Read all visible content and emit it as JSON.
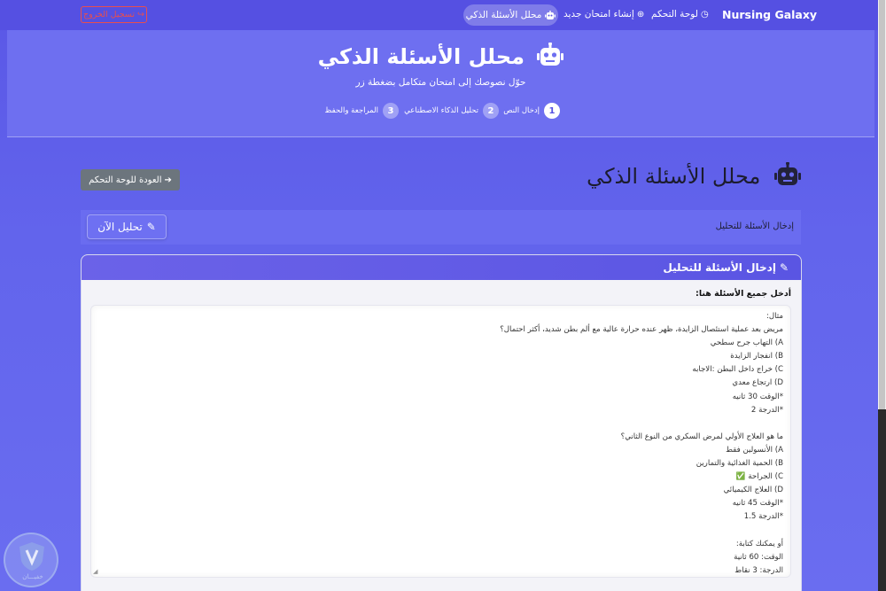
{
  "navbar": {
    "brand": "Nursing Galaxy",
    "dashboard": "لوحة التحكم",
    "new_exam": "إنشاء امتحان جديد",
    "analyzer": "محلل الأسئلة الذكي",
    "logout": "تسجيل الخروج"
  },
  "hero": {
    "title": "محلل الأسئلة الذكي",
    "subtitle": "حوّل نصوصك إلى امتحان متكامل بضغطة زر",
    "steps": [
      {
        "num": "1",
        "label": "إدخال النص"
      },
      {
        "num": "2",
        "label": "تحليل الذكاء الاصطناعي"
      },
      {
        "num": "3",
        "label": "المراجعة والحفظ"
      }
    ]
  },
  "page": {
    "title": "محلل الأسئلة الذكي",
    "back_button": "العودة للوحة التحكم"
  },
  "toolbar": {
    "label": "إدخال الأسئلة للتحليل",
    "analyze_button": "تحليل الآن"
  },
  "card": {
    "header": "إدخال الأسئلة للتحليل",
    "field_label": "أدخل جميع الأسئلة هنا:",
    "textarea_lines": [
      "مثال:",
      "مريض بعد عملية استئصال الزايدة، ظهر عنده حرارة عالية مع ألم بطن شديد، أكثر احتمال؟",
      "A) التهاب جرح سطحي",
      "B) انفجار الزايدة",
      "C) خراج داخل البطن :الاجابه",
      "D) ارتجاع معدي",
      "*الوقت 30 ثانيه",
      "*الدرجة 2",
      "",
      "ما هو العلاج الأولي لمرض السكري من النوع الثاني؟",
      "A) الأنسولين فقط",
      "B) الحمية الغذائية والتمارين",
      "C) الجراحة ✅",
      "D) العلاج الكيميائي",
      "*الوقت 45 ثانيه",
      "*الدرجة 1.5",
      "",
      "أو يمكنك كتابة:",
      "الوقت: 60 ثانية",
      "الدرجة: 3 نقاط"
    ]
  },
  "watermark": {
    "text": "خفيـــان"
  },
  "colors": {
    "primary": "#5550e2",
    "background": "#6264ec",
    "danger": "#e94e4e",
    "secondary": "#6c757d"
  }
}
